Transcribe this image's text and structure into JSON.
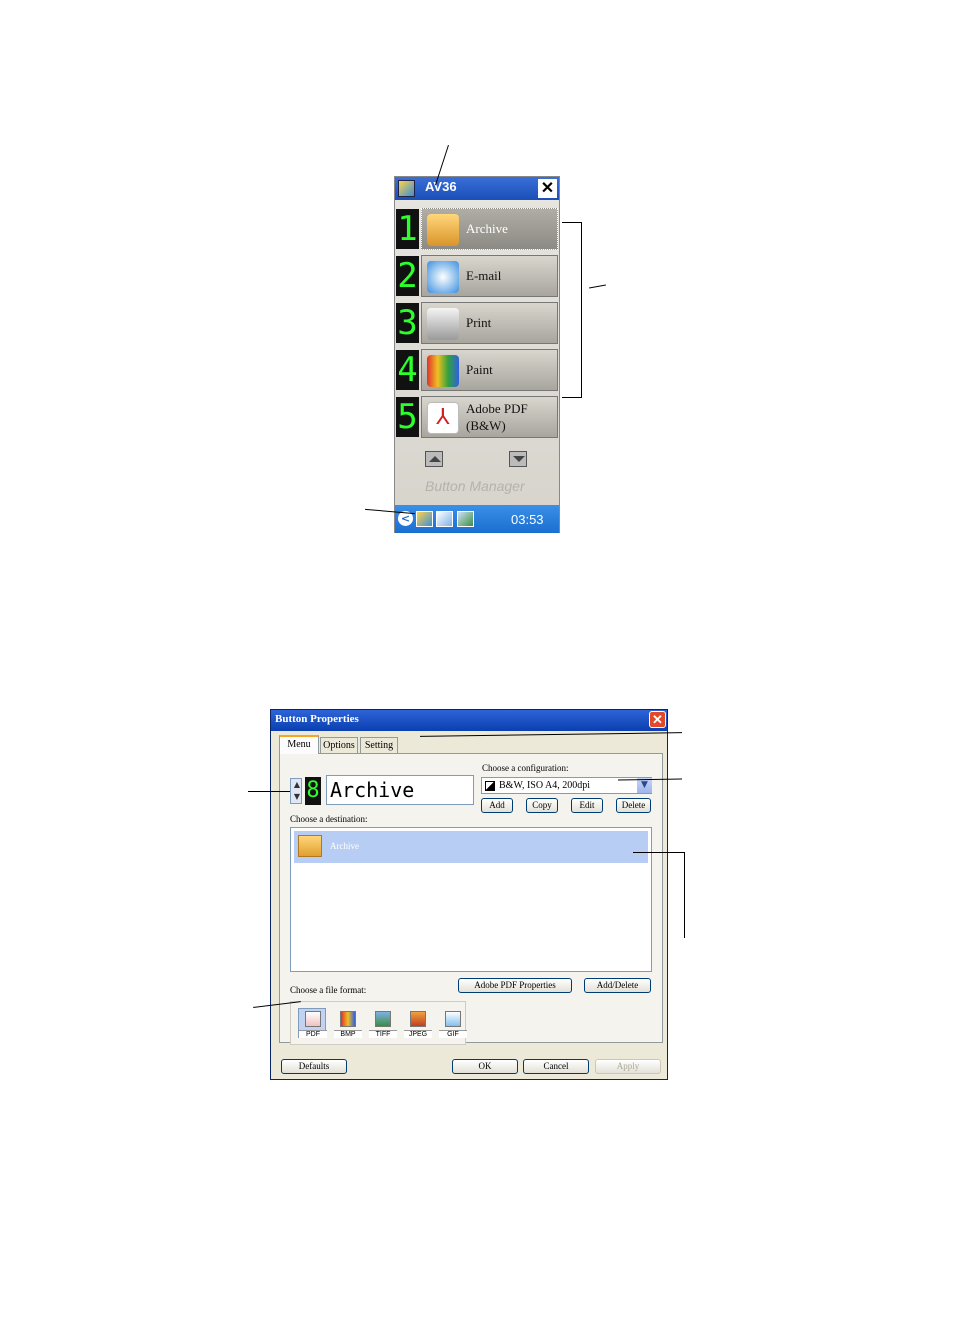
{
  "button_manager": {
    "title": "AV36",
    "close_label": "✕",
    "buttons": [
      {
        "digit": "1",
        "label": "Archive",
        "icon": "archive-folder-icon",
        "selected": true
      },
      {
        "digit": "2",
        "label": "E-mail",
        "icon": "email-icon",
        "selected": false
      },
      {
        "digit": "3",
        "label": "Print",
        "icon": "printer-icon",
        "selected": false
      },
      {
        "digit": "4",
        "label": "Paint",
        "icon": "paint-icon",
        "selected": false
      },
      {
        "digit": "5",
        "label": "Adobe PDF",
        "label_line2": "(B&W)",
        "icon": "pdf-icon",
        "selected": false
      }
    ],
    "brand": "Button Manager",
    "taskbar": {
      "time": "03:53",
      "back": "<"
    }
  },
  "dialog": {
    "title": "Button Properties",
    "close_label": "✕",
    "tabs": [
      {
        "label": "Menu",
        "active": true
      },
      {
        "label": "Options",
        "active": false
      },
      {
        "label": "Setting",
        "active": false
      }
    ],
    "button_number": "8",
    "button_name": "Archive",
    "config_label": "Choose a configuration:",
    "config_value": "B&W, ISO A4, 200dpi",
    "config_buttons": [
      "Add",
      "Copy",
      "Edit",
      "Delete"
    ],
    "dest_label": "Choose a destination:",
    "destinations": [
      {
        "label": "Archive",
        "selected": true
      }
    ],
    "pdf_properties_label": "Adobe PDF Properties",
    "add_delete_label": "Add/Delete",
    "format_label": "Choose a file format:",
    "formats": [
      {
        "label": "PDF",
        "selected": true
      },
      {
        "label": "BMP",
        "selected": false
      },
      {
        "label": "TIFF",
        "selected": false
      },
      {
        "label": "JPEG",
        "selected": false
      },
      {
        "label": "GIF",
        "selected": false
      }
    ],
    "footer": {
      "defaults": "Defaults",
      "ok": "OK",
      "cancel": "Cancel",
      "apply": "Apply"
    }
  },
  "colors": {
    "digit_green": "#2cff2c",
    "title_blue": "#1a4fb8",
    "selection_blue": "#b7cdf3"
  }
}
